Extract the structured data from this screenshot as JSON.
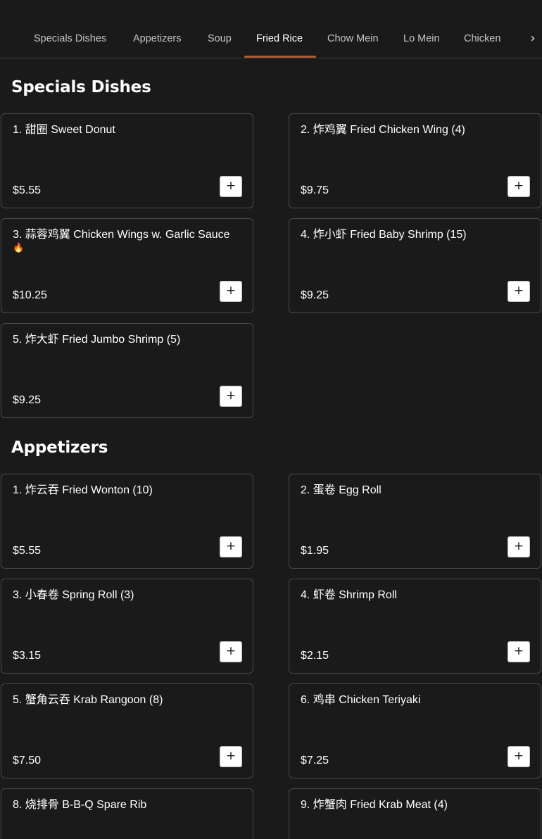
{
  "nav": {
    "tabs": [
      {
        "label": "Specials Dishes"
      },
      {
        "label": "Appetizers"
      },
      {
        "label": "Soup"
      },
      {
        "label": "Fried Rice",
        "active": true
      },
      {
        "label": "Chow Mein"
      },
      {
        "label": "Lo Mein"
      },
      {
        "label": "Chicken"
      }
    ],
    "more_icon": "chevron-right-icon",
    "more_glyph": "›"
  },
  "colors": {
    "background": "#1a1a1b",
    "active_tab_underline": "#b05a34",
    "card_border": "#4a4a4d",
    "spicy_icon": "#e0503a"
  },
  "add_glyph": "+",
  "spicy_glyph": "🔥",
  "sections": [
    {
      "title": "Specials Dishes",
      "items": [
        {
          "name": "1. 甜圈 Sweet Donut",
          "price": "$5.55"
        },
        {
          "name": "2. 炸鸡翼 Fried Chicken Wing (4)",
          "price": "$9.75"
        },
        {
          "name": "3. 蒜蓉鸡翼 Chicken Wings w. Garlic Sauce",
          "spicy": true,
          "spicy_icon": "fire-icon",
          "price": "$10.25"
        },
        {
          "name": "4. 炸小虾 Fried Baby Shrimp (15)",
          "price": "$9.25"
        },
        {
          "name": "5. 炸大虾 Fried Jumbo Shrimp (5)",
          "price": "$9.25"
        }
      ]
    },
    {
      "title": "Appetizers",
      "items": [
        {
          "name": "1. 炸云吞 Fried Wonton (10)",
          "price": "$5.55"
        },
        {
          "name": "2. 蛋卷 Egg Roll",
          "price": "$1.95"
        },
        {
          "name": "3. 小春卷 Spring Roll (3)",
          "price": "$3.15"
        },
        {
          "name": "4. 虾卷 Shrimp Roll",
          "price": "$2.15"
        },
        {
          "name": "5. 蟹角云吞 Krab Rangoon (8)",
          "price": "$7.50"
        },
        {
          "name": "6. 鸡串 Chicken Teriyaki",
          "price": "$7.25"
        },
        {
          "name": "8. 烧排骨 B-B-Q Spare Rib",
          "price": ""
        },
        {
          "name": "9. 炸蟹肉 Fried Krab Meat (4)",
          "price": ""
        }
      ]
    }
  ]
}
